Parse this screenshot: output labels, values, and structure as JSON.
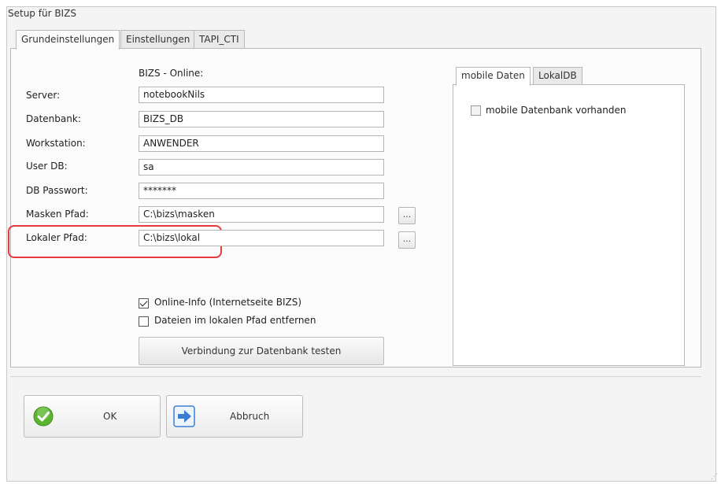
{
  "window": {
    "title": "Setup für BIZS"
  },
  "tabs": [
    {
      "label": "Grundeinstellungen",
      "active": true
    },
    {
      "label": "Einstellungen",
      "active": false
    },
    {
      "label": "TAPI_CTI",
      "active": false
    }
  ],
  "section_title": "BIZS - Online:",
  "fields": {
    "server": {
      "label": "Server:",
      "value": "notebookNils"
    },
    "datenbank": {
      "label": "Datenbank:",
      "value": "BIZS_DB"
    },
    "workstation": {
      "label": "Workstation:",
      "value": "ANWENDER"
    },
    "user_db": {
      "label": "User DB:",
      "value": "sa"
    },
    "db_passwort": {
      "label": "DB Passwort:",
      "value": "*******"
    },
    "masken_pfad": {
      "label": "Masken Pfad:",
      "value": "C:\\bizs\\masken"
    },
    "lokaler_pfad": {
      "label": "Lokaler Pfad:",
      "value": "C:\\bizs\\lokal"
    }
  },
  "browse_button_label": "...",
  "checkboxes": {
    "online_info": {
      "label": "Online-Info (Internetseite BIZS)",
      "checked": true
    },
    "dateien_entfernen": {
      "label": "Dateien im lokalen Pfad entfernen",
      "checked": false
    }
  },
  "test_button_label": "Verbindung zur Datenbank testen",
  "subtabs": [
    {
      "label": "mobile Daten",
      "active": true
    },
    {
      "label": "LokalDB",
      "active": false
    }
  ],
  "mobile": {
    "checkbox_label": "mobile Datenbank vorhanden",
    "checked": false
  },
  "buttons": {
    "ok": "OK",
    "cancel": "Abbruch"
  },
  "colors": {
    "highlight": "#e53b3b",
    "ok_icon": "#5cb531",
    "cancel_icon": "#3a7fd0"
  }
}
